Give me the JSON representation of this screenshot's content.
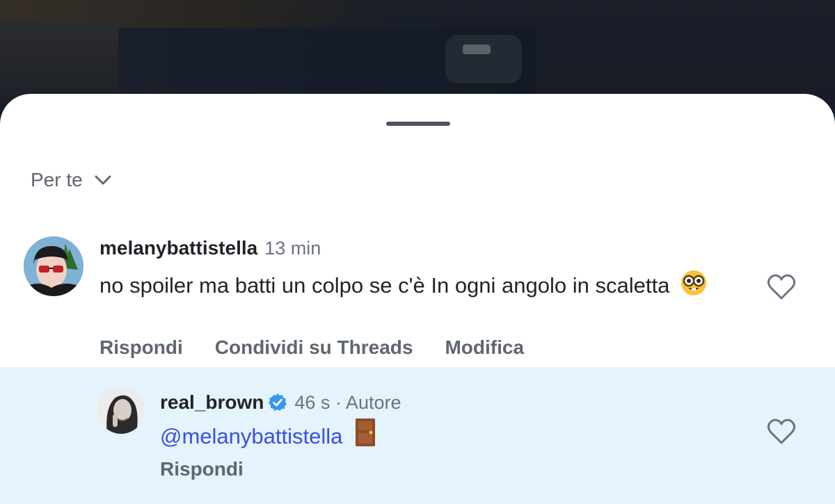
{
  "sheet": {
    "sort_label": "Per te"
  },
  "comments": [
    {
      "username": "melanybattistella",
      "time": "13 min",
      "text_prefix": "no spoiler ma batti un colpo se c'è In ogni angolo in scaletta",
      "emoji": "nerd-face",
      "actions": [
        "Rispondi",
        "Condividi su Threads",
        "Modifica"
      ]
    },
    {
      "username": "real_brown",
      "verified": true,
      "time": "46 s · Autore",
      "mention": "@melanybattistella",
      "emoji": "door",
      "actions": [
        "Rispondi"
      ]
    }
  ],
  "colors": {
    "reply_highlight": "#e4f3fc",
    "mention": "#3c4fe0",
    "verified": "#3897f0"
  }
}
